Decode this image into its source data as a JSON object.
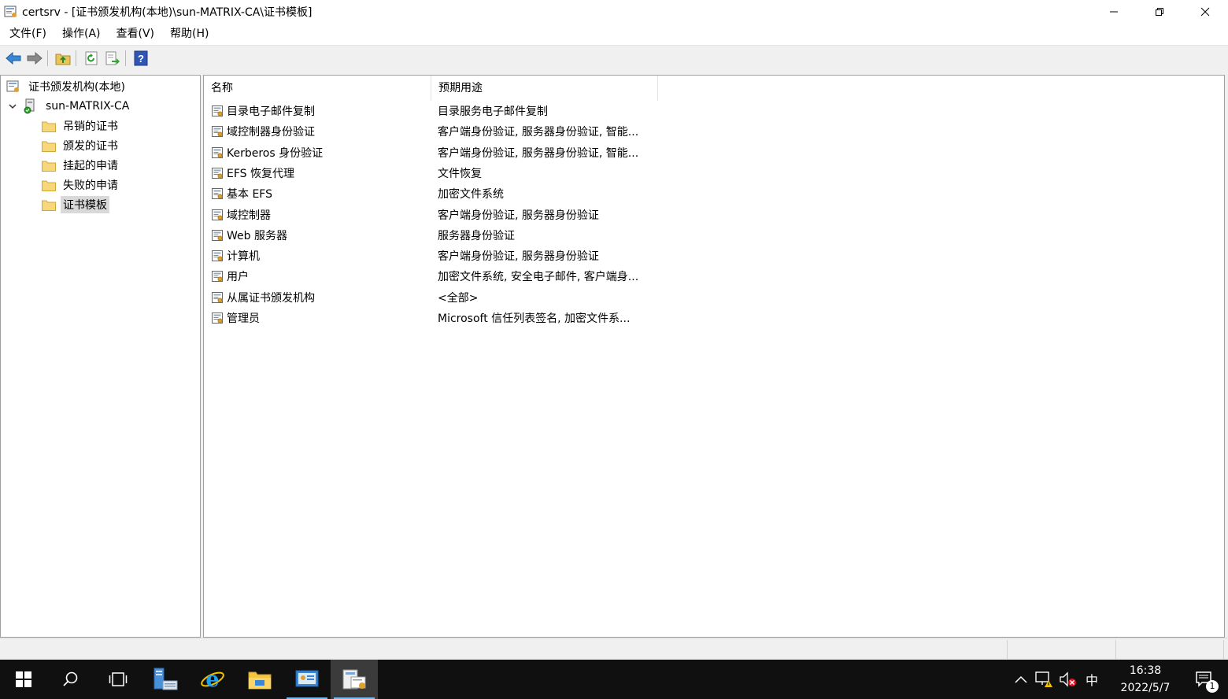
{
  "window": {
    "title": "certsrv - [证书颁发机构(本地)\\sun-MATRIX-CA\\证书模板]"
  },
  "menu": [
    {
      "label": "文件(F)"
    },
    {
      "label": "操作(A)"
    },
    {
      "label": "查看(V)"
    },
    {
      "label": "帮助(H)"
    }
  ],
  "tree": {
    "root": "证书颁发机构(本地)",
    "ca": "sun-MATRIX-CA",
    "folders": [
      {
        "label": "吊销的证书"
      },
      {
        "label": "颁发的证书"
      },
      {
        "label": "挂起的申请"
      },
      {
        "label": "失败的申请"
      },
      {
        "label": "证书模板",
        "selected": true
      }
    ]
  },
  "list": {
    "columns": {
      "name": "名称",
      "purpose": "预期用途"
    },
    "rows": [
      {
        "name": "目录电子邮件复制",
        "purpose": "目录服务电子邮件复制"
      },
      {
        "name": "域控制器身份验证",
        "purpose": "客户端身份验证, 服务器身份验证, 智能..."
      },
      {
        "name": "Kerberos 身份验证",
        "purpose": "客户端身份验证, 服务器身份验证, 智能..."
      },
      {
        "name": "EFS 恢复代理",
        "purpose": "文件恢复"
      },
      {
        "name": "基本 EFS",
        "purpose": "加密文件系统"
      },
      {
        "name": "域控制器",
        "purpose": "客户端身份验证, 服务器身份验证"
      },
      {
        "name": "Web 服务器",
        "purpose": "服务器身份验证"
      },
      {
        "name": "计算机",
        "purpose": "客户端身份验证, 服务器身份验证"
      },
      {
        "name": "用户",
        "purpose": "加密文件系统, 安全电子邮件, 客户端身..."
      },
      {
        "name": "从属证书颁发机构",
        "purpose": "<全部>"
      },
      {
        "name": "管理员",
        "purpose": "Microsoft 信任列表签名, 加密文件系..."
      }
    ]
  },
  "tray": {
    "ime": "中",
    "time": "16:38",
    "date": "2022/5/7",
    "notifications": "1"
  },
  "colors": {
    "taskbar": "#101010",
    "selection": "#d9d9d9",
    "accent": "#76b9ed"
  }
}
